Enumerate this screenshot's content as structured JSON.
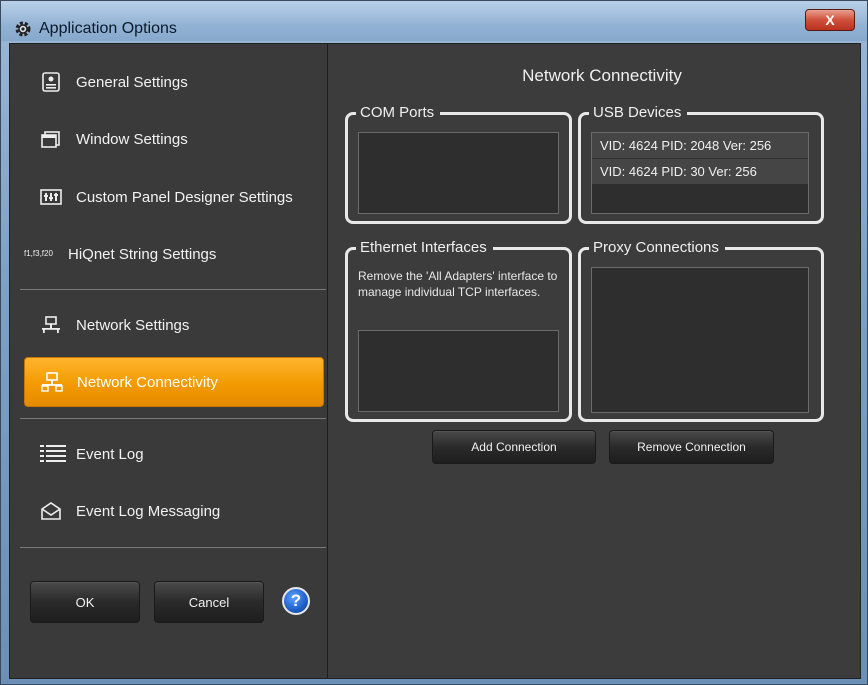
{
  "window": {
    "title": "Application Options",
    "close_label": "X"
  },
  "sidebar": {
    "items": [
      {
        "label": "General Settings",
        "icon": "general-settings-icon"
      },
      {
        "label": "Window Settings",
        "icon": "window-settings-icon"
      },
      {
        "label": "Custom Panel Designer Settings",
        "icon": "custom-panel-icon"
      },
      {
        "label": "HiQnet String Settings",
        "icon": "hiqnet-string-icon",
        "icon_text": "f1,f3,f20"
      },
      {
        "label": "Network Settings",
        "icon": "network-settings-icon"
      },
      {
        "label": "Network Connectivity",
        "icon": "network-connectivity-icon",
        "active": true
      },
      {
        "label": "Event Log",
        "icon": "event-log-icon"
      },
      {
        "label": "Event Log Messaging",
        "icon": "event-log-messaging-icon"
      }
    ],
    "ok_label": "OK",
    "cancel_label": "Cancel",
    "help_label": "?"
  },
  "main": {
    "title": "Network Connectivity",
    "com_ports": {
      "label": "COM Ports",
      "items": []
    },
    "usb_devices": {
      "label": "USB Devices",
      "items": [
        "VID: 4624 PID: 2048 Ver: 256",
        "VID: 4624 PID: 30 Ver: 256"
      ]
    },
    "ethernet": {
      "label": "Ethernet Interfaces",
      "description": "Remove the 'All Adapters' interface to manage individual TCP interfaces.",
      "items": []
    },
    "proxy": {
      "label": "Proxy Connections",
      "items": []
    },
    "add_connection_label": "Add Connection",
    "remove_connection_label": "Remove Connection"
  },
  "colors": {
    "accent": "#f29a00",
    "background": "#3c3c3c",
    "titlebar": "#93b3d4"
  }
}
